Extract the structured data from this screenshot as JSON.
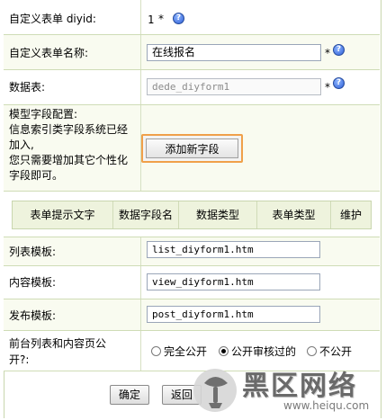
{
  "form": {
    "diyid": {
      "label": "自定义表单 diyid:",
      "value": "1",
      "required": "*"
    },
    "name": {
      "label": "自定义表单名称:",
      "value": "在线报名",
      "required": "*"
    },
    "table": {
      "label": "数据表:",
      "value": "dede_diyform1",
      "required": "*"
    },
    "model_fields": {
      "label_lines": [
        "模型字段配置:",
        "信息索引类字段系统已经",
        "加入,",
        "您只需要增加其它个性化",
        "字段即可。"
      ],
      "add_button": "添加新字段"
    },
    "field_table": {
      "headers": [
        "表单提示文字",
        "数据字段名",
        "数据类型",
        "表单类型",
        "维护"
      ]
    },
    "list_template": {
      "label": "列表模板:",
      "value": "list_diyform1.htm"
    },
    "content_template": {
      "label": "内容模板:",
      "value": "view_diyform1.htm"
    },
    "publish_template": {
      "label": "发布模板:",
      "value": "post_diyform1.htm"
    },
    "public": {
      "label_lines": [
        "前台列表和内容页公",
        "开?:"
      ],
      "options": [
        "完全公开",
        "公开审核过的",
        "不公开"
      ],
      "selected": "公开审核过的"
    },
    "actions": {
      "ok": "确定",
      "back": "返回"
    }
  },
  "watermark": {
    "text": "黑区网络",
    "url_text": "www.heiqu.com"
  },
  "colors": {
    "cream_row": "#f9fbf0",
    "header_row": "#eef3dd",
    "highlight": "#f0a04a"
  },
  "icons": {
    "help": "question-help-icon"
  }
}
